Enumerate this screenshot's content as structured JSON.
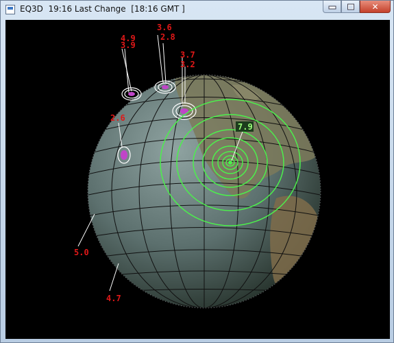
{
  "window": {
    "title": "EQ3D  19:16 Last Change  [18:16 GMT ]",
    "controls": {
      "minimize": "minimize",
      "maximize": "maximize",
      "close": "✕"
    }
  },
  "colors": {
    "background": "#000000",
    "globe_grid": "#101010",
    "quake_ring": "#ffffff",
    "quake_dot": "#c045c8",
    "major_ring": "#4cf04c",
    "label": "#e01818",
    "major_label": "#9cff7a"
  },
  "quakes": [
    {
      "magnitude": "4.9"
    },
    {
      "magnitude": "3.9"
    },
    {
      "magnitude": "3.6"
    },
    {
      "magnitude": "2.8"
    },
    {
      "magnitude": "3.7"
    },
    {
      "magnitude": "3.2"
    },
    {
      "magnitude": "2.6"
    },
    {
      "magnitude": "7.9",
      "major": true
    },
    {
      "magnitude": "5.0"
    },
    {
      "magnitude": "4.7"
    }
  ]
}
